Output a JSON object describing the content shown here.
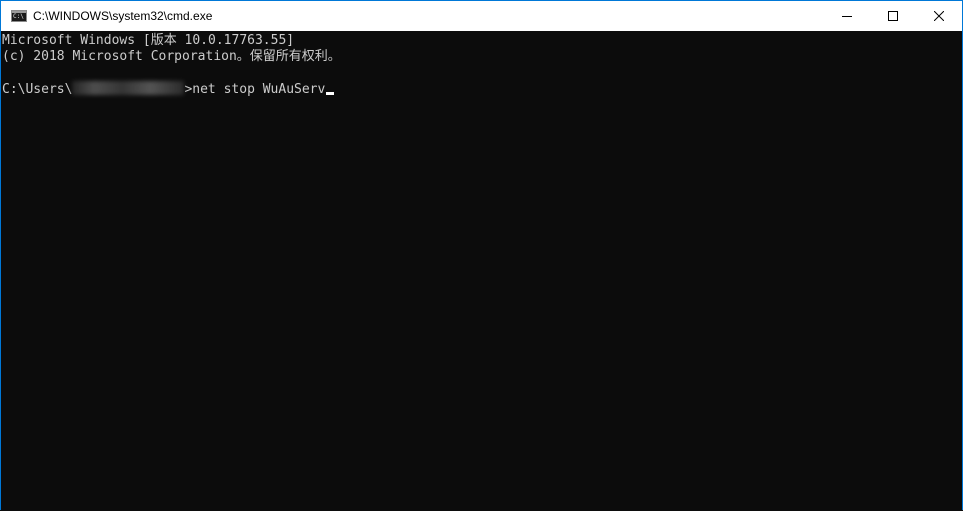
{
  "window": {
    "title": "C:\\WINDOWS\\system32\\cmd.exe",
    "icon_name": "cmd-icon",
    "icon_text": "C:\\",
    "accent_color": "#0078d7",
    "background_color": "#0c0c0c",
    "text_color": "#cccccc"
  },
  "controls": {
    "minimize": "minimize-icon",
    "maximize": "maximize-icon",
    "close": "close-icon"
  },
  "console": {
    "line1": "Microsoft Windows [版本 10.0.17763.55]",
    "line2": "(c) 2018 Microsoft Corporation。保留所有权利。",
    "prompt_prefix": "C:\\Users\\",
    "prompt_suffix": ">",
    "command": "net stop WuAuServ"
  }
}
